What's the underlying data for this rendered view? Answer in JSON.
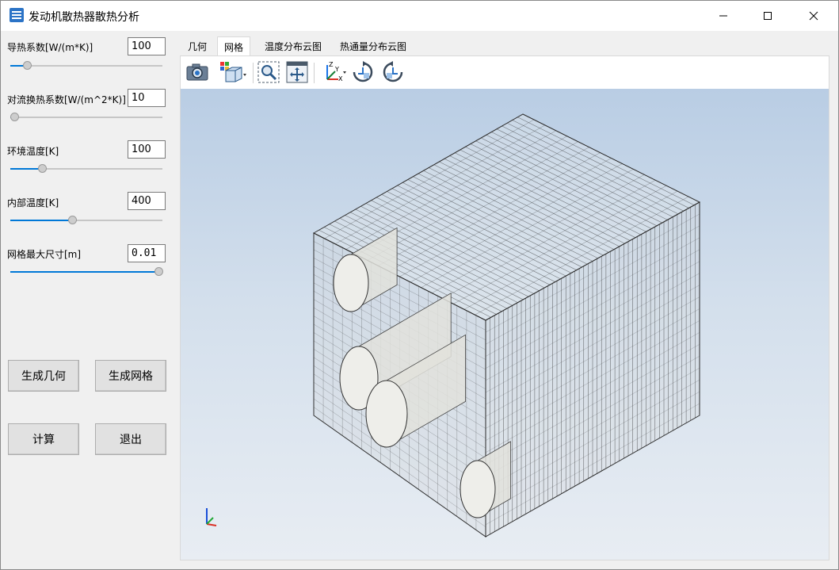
{
  "window": {
    "title": "发动机散热器散热分析",
    "icon": "app-icon",
    "controls": [
      "minimize-icon",
      "maximize-icon",
      "close-icon"
    ]
  },
  "params": [
    {
      "label": "导热系数[W/(m*K)]",
      "value": "100",
      "slider": 0.09
    },
    {
      "label": "对流换热系数[W/(m^2*K)]",
      "value": "10",
      "slider": 0.0
    },
    {
      "label": "环境温度[K]",
      "value": "100",
      "slider": 0.19
    },
    {
      "label": "内部温度[K]",
      "value": "400",
      "slider": 0.4
    },
    {
      "label": "网格最大尺寸[m]",
      "value": "0.01",
      "slider": 1.0
    }
  ],
  "buttons": {
    "gen_geometry": "生成几何",
    "gen_mesh": "生成网格",
    "calculate": "计算",
    "exit": "退出"
  },
  "tabs": [
    {
      "label": "几何",
      "active": false
    },
    {
      "label": "网格",
      "active": true
    },
    {
      "label": "温度分布云图",
      "active": false
    },
    {
      "label": "热通量分布云图",
      "active": false
    }
  ],
  "toolbar": [
    "camera-icon",
    "display-mode-icon",
    "zoom-fit-icon",
    "pan-icon",
    "axis-orientation-icon",
    "rotate-ccw-icon",
    "rotate-cw-icon"
  ],
  "axis_labels": {
    "z": "Z",
    "y": "Y",
    "x": "X"
  },
  "colors": {
    "accent": "#0078d7",
    "canvas_top": "#b9cde4",
    "canvas_bottom": "#e8edf3"
  }
}
